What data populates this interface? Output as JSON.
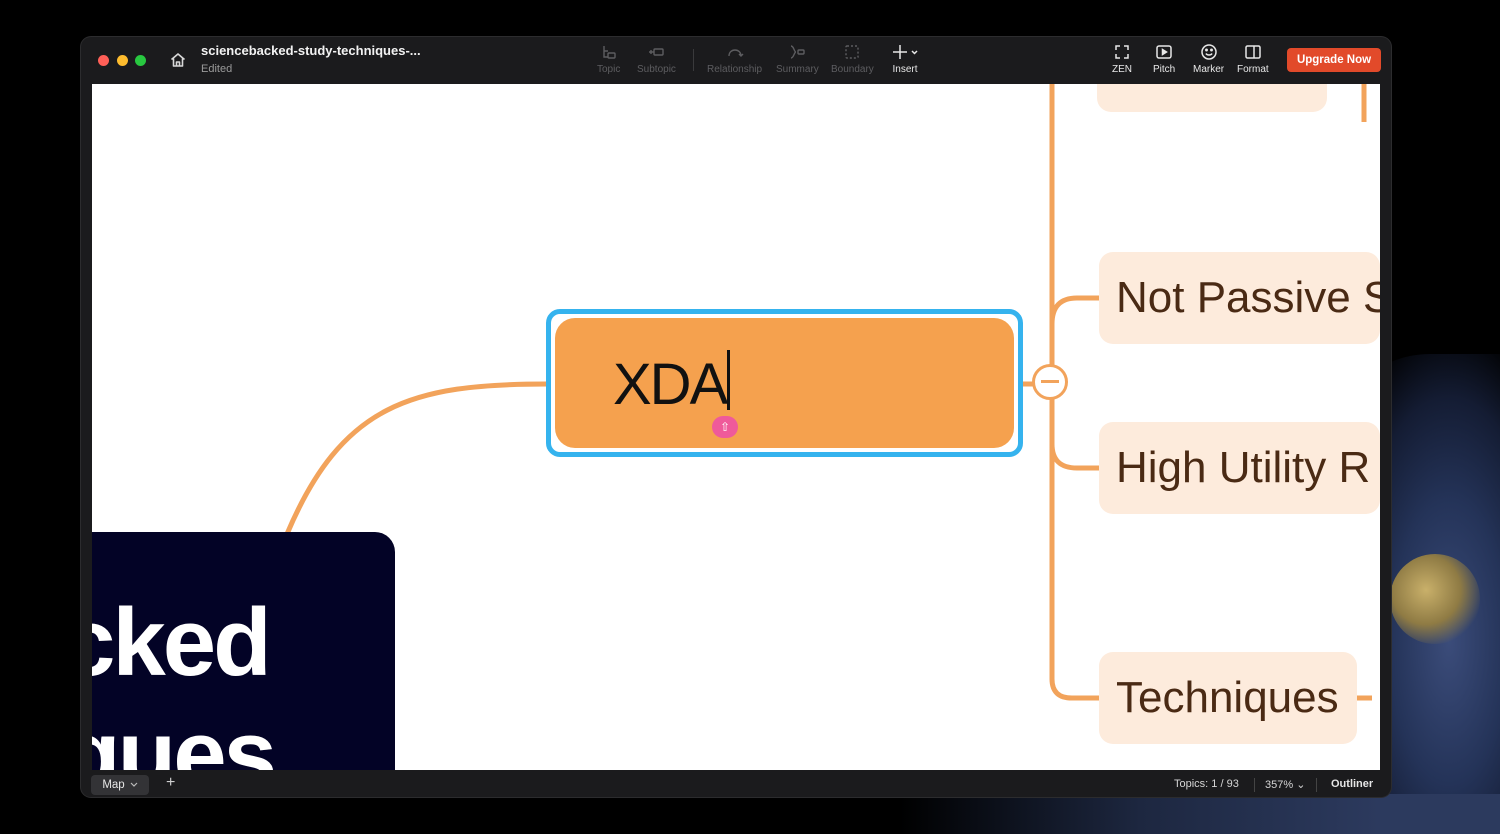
{
  "window": {
    "document_title": "sciencebacked-study-techniques-...",
    "status": "Edited"
  },
  "toolbar": {
    "tools": [
      {
        "label": "Topic",
        "icon": "topic-icon",
        "enabled": false
      },
      {
        "label": "Subtopic",
        "icon": "subtopic-icon",
        "enabled": false
      },
      {
        "label": "Relationship",
        "icon": "relationship-icon",
        "enabled": false
      },
      {
        "label": "Summary",
        "icon": "summary-icon",
        "enabled": false
      },
      {
        "label": "Boundary",
        "icon": "boundary-icon",
        "enabled": false
      },
      {
        "label": "Insert",
        "icon": "plus-icon",
        "enabled": true
      }
    ],
    "right_tools": [
      {
        "label": "ZEN",
        "icon": "fullscreen-icon"
      },
      {
        "label": "Pitch",
        "icon": "play-icon"
      },
      {
        "label": "Marker",
        "icon": "smiley-icon"
      },
      {
        "label": "Format",
        "icon": "panel-icon"
      }
    ],
    "upgrade_label": "Upgrade Now"
  },
  "canvas": {
    "central_topic_lines": [
      "cked",
      "ques"
    ],
    "selected_topic_text": "XDA",
    "subtopics": [
      "Not Passive S",
      "High Utility R",
      "Techniques"
    ]
  },
  "statusbar": {
    "view_tab": "Map",
    "add_sheet": "+",
    "topics": "Topics: 1 / 93",
    "zoom": "357%",
    "outliner": "Outliner"
  },
  "colors": {
    "accent_upgrade": "#e24a2a",
    "topic_orange": "#f5a14e",
    "selection_blue": "#35b3ee",
    "central_navy": "#030326",
    "subtopic_peach": "#fdebdc",
    "branch_line": "#f2a35b"
  }
}
